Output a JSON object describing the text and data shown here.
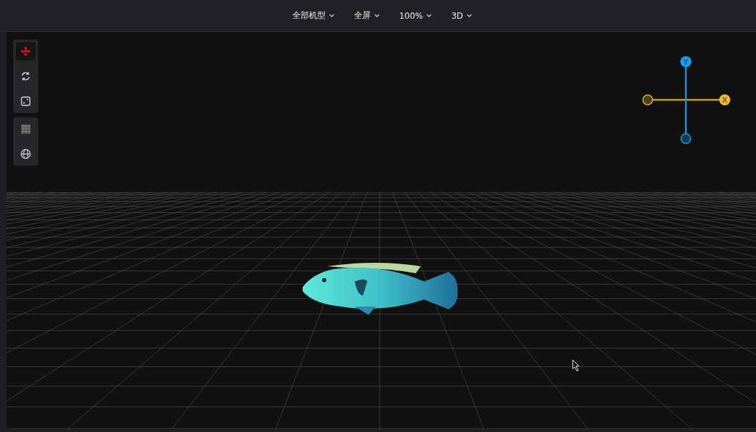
{
  "toolbar": {
    "dropdowns": [
      {
        "label": "全部机型"
      },
      {
        "label": "全屏"
      },
      {
        "label": "100%"
      },
      {
        "label": "3D"
      }
    ]
  },
  "tool_groups": [
    {
      "tools": [
        {
          "kind": "move",
          "selected": true
        },
        {
          "kind": "rotate",
          "selected": false
        },
        {
          "kind": "scale",
          "selected": false
        }
      ]
    },
    {
      "tools": [
        {
          "kind": "grid",
          "selected": false
        },
        {
          "kind": "globe",
          "selected": false
        }
      ]
    }
  ],
  "axis_gizmo": {
    "y_label": "Y",
    "x_label": "X"
  }
}
